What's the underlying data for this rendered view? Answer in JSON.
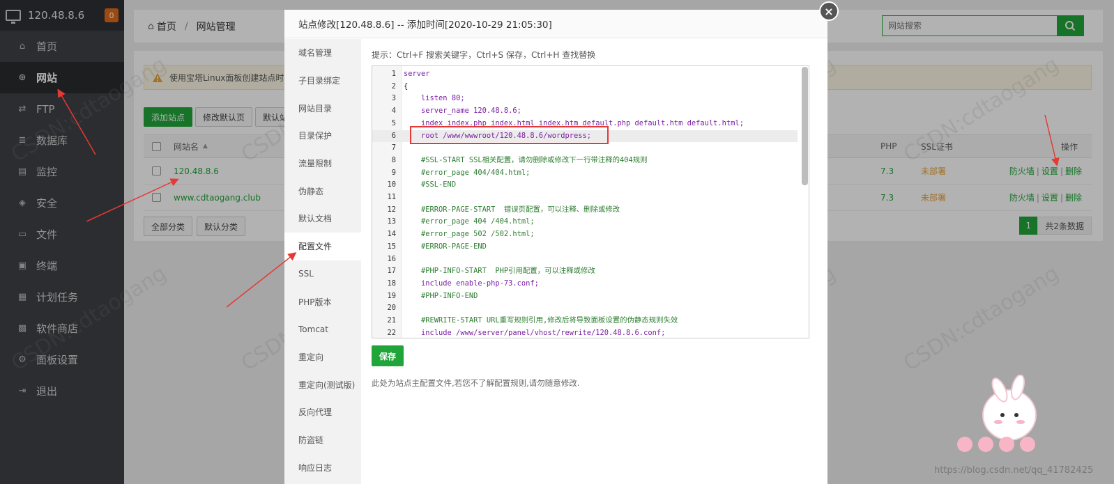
{
  "sidebar": {
    "server_ip": "120.48.8.6",
    "badge": "0",
    "items": [
      {
        "label": "首页",
        "icon": "home-icon"
      },
      {
        "label": "网站",
        "icon": "globe-icon"
      },
      {
        "label": "FTP",
        "icon": "ftp-icon"
      },
      {
        "label": "数据库",
        "icon": "database-icon"
      },
      {
        "label": "监控",
        "icon": "monitor-icon"
      },
      {
        "label": "安全",
        "icon": "shield-icon"
      },
      {
        "label": "文件",
        "icon": "folder-icon"
      },
      {
        "label": "终端",
        "icon": "terminal-icon"
      },
      {
        "label": "计划任务",
        "icon": "calendar-icon"
      },
      {
        "label": "软件商店",
        "icon": "apps-icon"
      },
      {
        "label": "面板设置",
        "icon": "gear-icon"
      },
      {
        "label": "退出",
        "icon": "logout-icon"
      }
    ]
  },
  "breadcrumb": {
    "home": "首页",
    "sep": "/",
    "current": "网站管理"
  },
  "search": {
    "placeholder": "网站搜索"
  },
  "notice": "使用宝塔Linux面板创建站点时",
  "toolbar": {
    "add_site": "添加站点",
    "modify_default": "修改默认页",
    "default_site": "默认站"
  },
  "table": {
    "headers": {
      "site_name": "网站名",
      "php": "PHP",
      "ssl": "SSL证书",
      "ops": "操作"
    },
    "rows": [
      {
        "name": "120.48.8.6",
        "php": "7.3",
        "ssl": "未部署",
        "firewall": "防火墙",
        "settings": "设置",
        "delete": "删除"
      },
      {
        "name": "www.cdtaogang.club",
        "php": "7.3",
        "ssl": "未部署",
        "firewall": "防火墙",
        "settings": "设置",
        "delete": "删除"
      }
    ],
    "divider": "|"
  },
  "category": {
    "all": "全部分类",
    "default": "默认分类"
  },
  "pager": {
    "page": "1",
    "total": "共2条数据"
  },
  "modal": {
    "title": "站点修改[120.48.8.6] -- 添加时间[2020-10-29 21:05:30]",
    "close": "×",
    "nav": [
      "域名管理",
      "子目录绑定",
      "网站目录",
      "目录保护",
      "流量限制",
      "伪静态",
      "默认文档",
      "配置文件",
      "SSL",
      "PHP版本",
      "Tomcat",
      "重定向",
      "重定向(测试版)",
      "反向代理",
      "防盗链",
      "响应日志"
    ],
    "hint": "提示：Ctrl+F 搜索关键字，Ctrl+S 保存，Ctrl+H 查找替换",
    "save": "保存",
    "note": "此处为站点主配置文件,若您不了解配置规则,请勿随意修改.",
    "code": [
      {
        "n": "1",
        "t": "server"
      },
      {
        "n": "2",
        "t": "{"
      },
      {
        "n": "3",
        "t": "    listen 80;"
      },
      {
        "n": "4",
        "t": "    server_name 120.48.8.6;"
      },
      {
        "n": "5",
        "t": "    index index.php index.html index.htm default.php default.htm default.html;"
      },
      {
        "n": "6",
        "t": "    root /www/wwwroot/120.48.8.6/wordpress;"
      },
      {
        "n": "7",
        "t": ""
      },
      {
        "n": "8",
        "t": "    #SSL-START SSL相关配置，请勿删除或修改下一行带注释的404规则"
      },
      {
        "n": "9",
        "t": "    #error_page 404/404.html;"
      },
      {
        "n": "10",
        "t": "    #SSL-END"
      },
      {
        "n": "11",
        "t": ""
      },
      {
        "n": "12",
        "t": "    #ERROR-PAGE-START  错误页配置，可以注释、删除或修改"
      },
      {
        "n": "13",
        "t": "    #error_page 404 /404.html;"
      },
      {
        "n": "14",
        "t": "    #error_page 502 /502.html;"
      },
      {
        "n": "15",
        "t": "    #ERROR-PAGE-END"
      },
      {
        "n": "16",
        "t": ""
      },
      {
        "n": "17",
        "t": "    #PHP-INFO-START  PHP引用配置，可以注释或修改"
      },
      {
        "n": "18",
        "t": "    include enable-php-73.conf;"
      },
      {
        "n": "19",
        "t": "    #PHP-INFO-END"
      },
      {
        "n": "20",
        "t": ""
      },
      {
        "n": "21",
        "t": "    #REWRITE-START URL重写规则引用,修改后将导致面板设置的伪静态规则失效"
      },
      {
        "n": "22",
        "t": "    include /www/server/panel/vhost/rewrite/120.48.8.6.conf;"
      }
    ]
  },
  "watermark": "CSDN:cdtaogang",
  "footer_url": "https://blog.csdn.net/qq_41782425",
  "colors": {
    "accent": "#20a53a",
    "sidebar": "#3f4146",
    "arrow": "#e53935",
    "warning": "#e6a23c"
  }
}
